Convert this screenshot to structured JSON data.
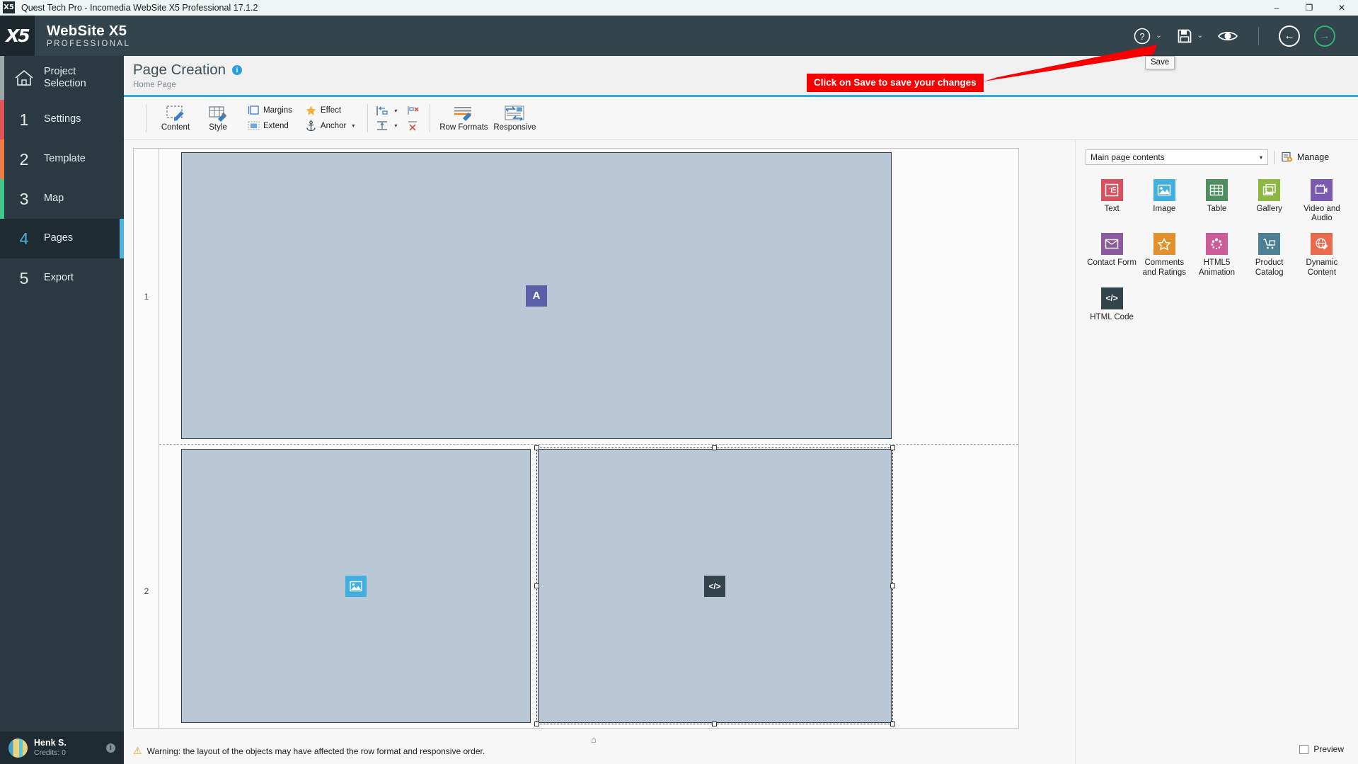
{
  "window": {
    "title": "Quest Tech Pro - Incomedia WebSite X5 Professional 17.1.2",
    "app_icon": "x5-app-icon",
    "minimize": "–",
    "maximize": "❐",
    "close": "✕"
  },
  "header": {
    "brand_line1": "WebSite X5",
    "brand_line2": "PROFESSIONAL",
    "help_icon": "question-circle-icon",
    "help_caret": "⌄",
    "save_icon": "floppy-disk-icon",
    "save_caret": "⌄",
    "preview_icon": "eye-icon",
    "back_icon": "←",
    "next_icon": "→",
    "save_tooltip": "Save"
  },
  "callout": {
    "text": "Click on Save to save your changes",
    "color": "#f80000"
  },
  "sidebar": {
    "items": [
      {
        "num": "",
        "label": "Project\nSelection",
        "label_l1": "Project",
        "label_l2": "Selection",
        "icon": "home-icon",
        "accent": "#9aa8ae",
        "active": false
      },
      {
        "num": "1",
        "label": "Settings",
        "accent": "#e3535c",
        "active": false
      },
      {
        "num": "2",
        "label": "Template",
        "accent": "#ef7d43",
        "active": false
      },
      {
        "num": "3",
        "label": "Map",
        "accent": "#3ec98a",
        "active": false
      },
      {
        "num": "4",
        "label": "Pages",
        "accent": "#4fb3e0",
        "active": true
      },
      {
        "num": "5",
        "label": "Export",
        "accent": "#2b3a42",
        "active": false
      }
    ],
    "collapse_icon": "chevron-left-icon",
    "user": {
      "name": "Henk S.",
      "credits": "Credits: 0",
      "info_icon": "info-icon"
    }
  },
  "page": {
    "title": "Page Creation",
    "info_icon": "info-icon",
    "subtitle": "Home Page"
  },
  "toolbar": {
    "groups": [
      {
        "buttons": [
          {
            "label": "Content",
            "icon": "content-pencil-icon"
          },
          {
            "label": "Style",
            "icon": "style-brush-icon"
          }
        ]
      },
      {
        "stacked": [
          {
            "label": "Margins",
            "icon": "margins-icon"
          },
          {
            "label": "Extend",
            "icon": "extend-icon"
          }
        ]
      },
      {
        "stacked": [
          {
            "label": "Effect",
            "icon": "star-effect-icon"
          },
          {
            "label": "Anchor",
            "icon": "anchor-icon",
            "caret": "▾"
          }
        ]
      },
      {
        "stacked_icons": [
          {
            "icon": "align-left-icon",
            "caret": "▾"
          },
          {
            "icon": "distribute-icon",
            "caret": "▾"
          }
        ]
      },
      {
        "stacked_icons": [
          {
            "icon": "remove-horizontal-icon"
          },
          {
            "icon": "remove-vertical-icon"
          }
        ]
      },
      {
        "buttons": [
          {
            "label": "Row Formats",
            "icon": "row-formats-icon"
          },
          {
            "label": "Responsive",
            "icon": "responsive-icon"
          }
        ]
      }
    ]
  },
  "canvas": {
    "rows": [
      {
        "number": "1"
      },
      {
        "number": "2"
      }
    ],
    "cells": [
      {
        "row": "1",
        "object": "Text",
        "badge_icon": "text-A-icon",
        "badge_label": "A",
        "badge_color": "#5b5fa7",
        "selected": false
      },
      {
        "row": "2",
        "object": "Image",
        "badge_icon": "image-icon",
        "badge_label": "⛰",
        "badge_color": "#41b0e0",
        "selected": false
      },
      {
        "row": "2",
        "object": "HTML Code",
        "badge_icon": "html-code-icon",
        "badge_label": "</>",
        "badge_color": "#33444d",
        "selected": true
      }
    ],
    "anchor_icon": "home-anchor-icon",
    "warning": "Warning: the layout of the objects may have affected the row format and responsive order.",
    "warning_icon": "warning-triangle-icon"
  },
  "right_panel": {
    "selected_scope": "Main page contents",
    "scope_caret": "▾",
    "manage_label": "Manage",
    "manage_icon": "manage-gear-icon",
    "objects": [
      {
        "label": "Text",
        "icon": "text-icon",
        "color": "#d9505f"
      },
      {
        "label": "Image",
        "icon": "image-icon",
        "color": "#41b0e0"
      },
      {
        "label": "Table",
        "icon": "table-icon",
        "color": "#4e8e5e"
      },
      {
        "label": "Gallery",
        "icon": "gallery-icon",
        "color": "#8cb843"
      },
      {
        "label": "Video and Audio",
        "icon": "video-audio-icon",
        "color": "#7a5bb0"
      },
      {
        "label": "Contact Form",
        "icon": "contact-form-icon",
        "color": "#8c5a9e"
      },
      {
        "label": "Comments and Ratings",
        "icon": "comments-ratings-icon",
        "color": "#e2902b"
      },
      {
        "label": "HTML5 Animation",
        "icon": "html5-animation-icon",
        "color": "#cc5b9a"
      },
      {
        "label": "Product Catalog",
        "icon": "product-catalog-icon",
        "color": "#4c7f93"
      },
      {
        "label": "Dynamic Content",
        "icon": "dynamic-content-icon",
        "color": "#ea6a4e"
      },
      {
        "label": "HTML Code",
        "icon": "html-code-icon",
        "color": "#33444d"
      }
    ],
    "preview_label": "Preview",
    "preview_checked": false
  }
}
